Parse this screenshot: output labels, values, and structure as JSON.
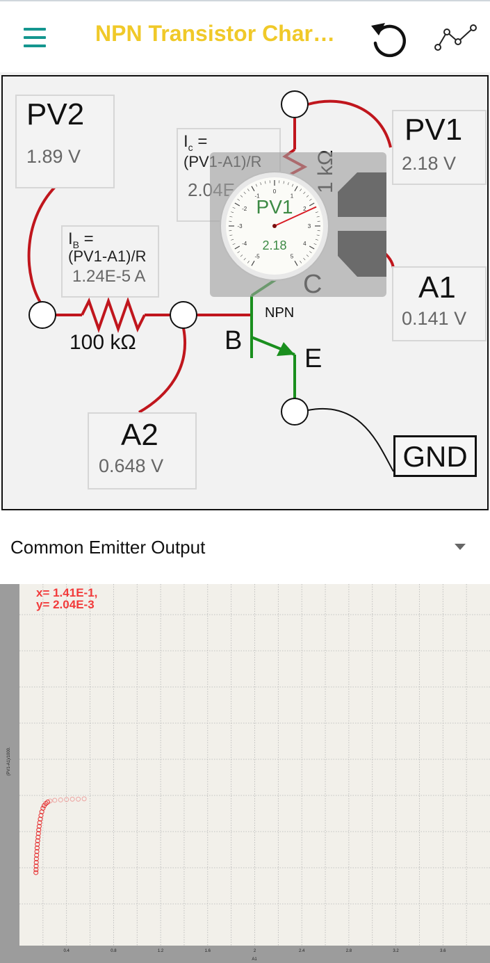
{
  "app": {
    "title": "NPN Transistor Char…",
    "icons": {
      "menu": "hamburger-menu-icon",
      "undo": "undo-icon",
      "graph": "line-graph-icon"
    },
    "colors": {
      "title": "#f0c929",
      "menu": "#14968f"
    }
  },
  "circuit": {
    "probes": {
      "pv2": {
        "name": "PV2",
        "value": "1.89 V"
      },
      "pv1": {
        "name": "PV1",
        "value": "2.18 V"
      },
      "a1": {
        "name": "A1",
        "value": "0.141 V"
      },
      "a2": {
        "name": "A2",
        "value": "0.648 V"
      }
    },
    "ib": {
      "label1": "I",
      "label1_sub": "B",
      "label1_tail": " =",
      "formula": "(PV1-A1)/R",
      "value": "1.24E-5 A"
    },
    "ic": {
      "label1": "I",
      "label1_sub": "c",
      "label1_tail": " =",
      "formula": "(PV1-A1)/R",
      "value": "2.04E"
    },
    "resistor_base": "100 kΩ",
    "resistor_collector": "1 kΩ",
    "transistor": "NPN",
    "terminals": {
      "base": "B",
      "emitter": "E",
      "collector": "C"
    },
    "ground": "GND",
    "gauge": {
      "title": "PV1",
      "value": "2.18",
      "reading": 2.18,
      "scale_min": -5,
      "scale_max": 5,
      "ticks": [
        "-5",
        "-4",
        "-3",
        "-2",
        "-1",
        "0",
        "1",
        "2",
        "3",
        "4",
        "5"
      ]
    },
    "colors": {
      "wire": "#c0161d",
      "transistor": "#1a8f1e",
      "ground_wire": "#111111"
    }
  },
  "selector": {
    "label": "Common Emitter Output"
  },
  "chart_data": {
    "type": "scatter",
    "readout": {
      "x": "x= 1.41E-1,",
      "y": "y= 2.04E-3"
    },
    "xlabel": "A1",
    "ylabel": "(PV1-A1)/1000.",
    "x_ticks": [
      "0.4",
      "0.8",
      "1.2",
      "1.6",
      "2",
      "2.4",
      "2.8",
      "3.2",
      "3.6"
    ],
    "xlim": [
      0,
      4.0
    ],
    "ylim": [
      0,
      1
    ],
    "series_color": "#e41a1c",
    "points": [
      [
        0.14,
        0.202
      ],
      [
        0.141,
        0.21
      ],
      [
        0.142,
        0.22
      ],
      [
        0.143,
        0.23
      ],
      [
        0.144,
        0.24
      ],
      [
        0.146,
        0.25
      ],
      [
        0.148,
        0.26
      ],
      [
        0.15,
        0.27
      ],
      [
        0.152,
        0.28
      ],
      [
        0.155,
        0.29
      ],
      [
        0.158,
        0.3
      ],
      [
        0.161,
        0.31
      ],
      [
        0.164,
        0.32
      ],
      [
        0.168,
        0.33
      ],
      [
        0.172,
        0.34
      ],
      [
        0.177,
        0.35
      ],
      [
        0.183,
        0.36
      ],
      [
        0.19,
        0.37
      ],
      [
        0.2,
        0.38
      ],
      [
        0.21,
        0.387
      ],
      [
        0.225,
        0.393
      ],
      [
        0.24,
        0.397
      ],
      [
        0.26,
        0.4
      ],
      [
        0.3,
        0.402
      ],
      [
        0.35,
        0.403
      ],
      [
        0.4,
        0.404
      ],
      [
        0.45,
        0.405
      ],
      [
        0.5,
        0.405
      ],
      [
        0.55,
        0.406
      ]
    ]
  }
}
